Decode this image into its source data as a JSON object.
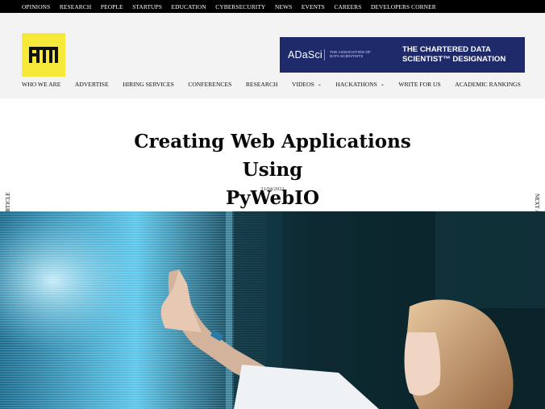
{
  "topnav": [
    "OPINIONS",
    "RESEARCH",
    "PEOPLE",
    "STARTUPS",
    "EDUCATION",
    "CYBERSECURITY",
    "NEWS",
    "EVENTS",
    "CAREERS",
    "DEVELOPERS CORNER"
  ],
  "logo": {
    "icon": "aim-logo"
  },
  "banner": {
    "brand": "ADaSci",
    "sub": "THE ASSOCIATION OF DATA SCIENTISTS",
    "title_line1": "THE CHARTERED DATA",
    "title_line2": "SCIENTIST™ DESIGNATION",
    "bg_color": "#1f2a6b"
  },
  "mainnav": [
    {
      "label": "WHO WE ARE"
    },
    {
      "label": "ADVERTISE"
    },
    {
      "label": "HIRING SERVICES"
    },
    {
      "label": "CONFERENCES"
    },
    {
      "label": "RESEARCH"
    },
    {
      "label": "VIDEOS",
      "dropdown": true
    },
    {
      "label": "HACKATHONS",
      "dropdown": true
    },
    {
      "label": "WRITE FOR US"
    },
    {
      "label": "ACADEMIC RANKINGS"
    }
  ],
  "article": {
    "title_line1": "Creating Web Applications Using",
    "title_line2": "PyWebIO",
    "date": "21/04/2021"
  },
  "side": {
    "prev": "PREVIOUS ARTICLE",
    "next": "NEXT ARTICLE"
  },
  "hero": {
    "alt_icon": "woman-touching-data-screen-image"
  },
  "colors": {
    "topbar": "#000000",
    "logo": "#f7e93a",
    "header_bg": "#f3f3f3"
  }
}
